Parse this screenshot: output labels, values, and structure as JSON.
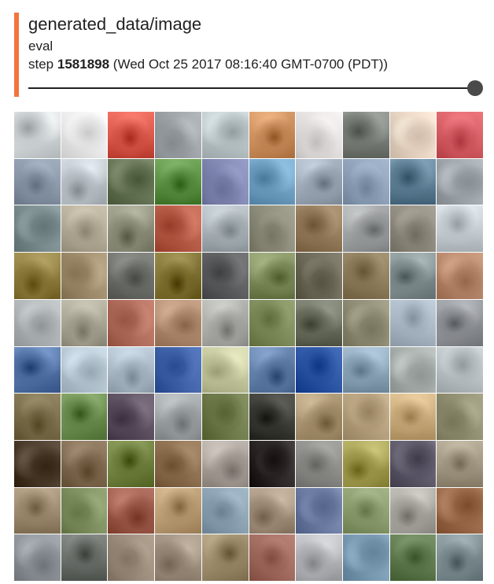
{
  "card": {
    "tag": "generated_data/image",
    "run": "eval",
    "step_prefix": "step",
    "step_value": "1581898",
    "step_time": "(Wed Oct 25 2017 08:16:40 GMT-0700 (PDT))",
    "accent_color": "#f4743b"
  },
  "slider": {
    "position": 1.0
  },
  "image_grid": {
    "rows": 10,
    "columns": 10,
    "tile_colors": [
      [
        "#cfd4d6",
        "#e9e9ea",
        "#d7574a",
        "#9aa0a4",
        "#b9c4c6",
        "#c78b5a",
        "#e1dcdc",
        "#7a7f79",
        "#e8d4c2",
        "#d45c63"
      ],
      [
        "#8795a6",
        "#b9c1c7",
        "#667456",
        "#5a8f43",
        "#7f86b0",
        "#6f9fc0",
        "#9aa6b4",
        "#8da0b8",
        "#5f7f95",
        "#9ea5aa"
      ],
      [
        "#7b8c8e",
        "#b2a996",
        "#8c8e7a",
        "#b45a45",
        "#a7b0b5",
        "#8d8c7a",
        "#937a5a",
        "#9a9d9e",
        "#8f8a7e",
        "#c4ccd2"
      ],
      [
        "#8b7a3c",
        "#9c8a6a",
        "#6d6f6a",
        "#7d6f30",
        "#5d5e5f",
        "#7c8a5a",
        "#6d6a5a",
        "#8c7c5c",
        "#7f8d8f",
        "#b6866a"
      ],
      [
        "#aeb3b5",
        "#a6a291",
        "#b06c5a",
        "#b08a6e",
        "#a7a8a4",
        "#7d8b5a",
        "#6a6e5e",
        "#8e8c74",
        "#a9b7c4",
        "#8e9196"
      ],
      [
        "#5272a5",
        "#b5c6d2",
        "#a7b6c3",
        "#3f62a8",
        "#c1c49b",
        "#5d7aa5",
        "#2c55a3",
        "#8aa3b7",
        "#a6adaa",
        "#b9c0c4"
      ],
      [
        "#7a6d4a",
        "#6a8d4f",
        "#5a4e5e",
        "#9a9fa2",
        "#6e7a4a",
        "#3a3b35",
        "#a48f6c",
        "#b5a07d",
        "#c7a97a",
        "#8e8c6e"
      ],
      [
        "#4a3a2a",
        "#7f6a50",
        "#6e7f3e",
        "#8a6d4d",
        "#a49c95",
        "#2c2726",
        "#8a8a86",
        "#a09a4e",
        "#5e5a6a",
        "#a09681"
      ],
      [
        "#9c8a6e",
        "#7c8e5e",
        "#9c5a4a",
        "#b89a72",
        "#8aa0b0",
        "#a08e7a",
        "#6c7ca2",
        "#8a9c6e",
        "#a7a49e",
        "#9a6a4a"
      ],
      [
        "#8c9298",
        "#6a6f6a",
        "#9a8a7a",
        "#9a8a7a",
        "#9a8a6a",
        "#a06a5e",
        "#b0b2b6",
        "#7a9ab2",
        "#5e7a4e",
        "#7a8a8e"
      ]
    ]
  }
}
